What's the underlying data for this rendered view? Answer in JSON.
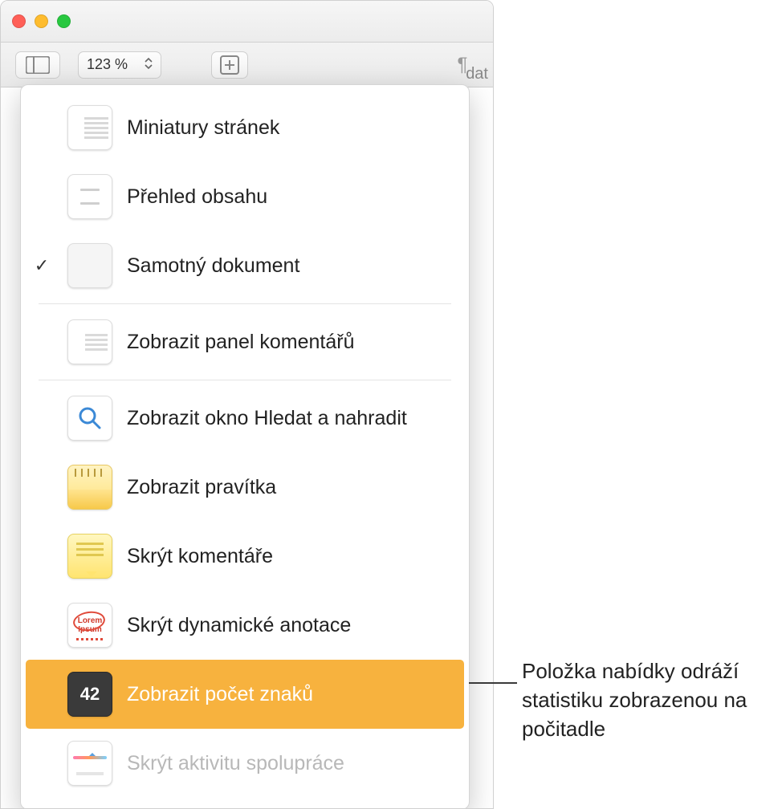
{
  "toolbar": {
    "zoom_value": "123 %",
    "partial_label": "dat"
  },
  "menu": {
    "items": [
      {
        "label": "Miniatury stránek",
        "checked": false
      },
      {
        "label": "Přehled obsahu",
        "checked": false
      },
      {
        "label": "Samotný dokument",
        "checked": true
      },
      {
        "label": "Zobrazit panel komentářů",
        "checked": false
      },
      {
        "label": "Zobrazit okno Hledat a nahradit",
        "checked": false
      },
      {
        "label": "Zobrazit pravítka",
        "checked": false
      },
      {
        "label": "Skrýt komentáře",
        "checked": false
      },
      {
        "label": "Skrýt dynamické anotace",
        "checked": false
      },
      {
        "label": "Zobrazit počet znaků",
        "checked": false,
        "selected": true,
        "badge": "42"
      },
      {
        "label": "Skrýt aktivitu spolupráce",
        "checked": false,
        "disabled": true
      }
    ],
    "lorem_icon_text": "Lorem Ipsum"
  },
  "callout": "Položka nabídky odráží statistiku zobrazenou na počitadle"
}
